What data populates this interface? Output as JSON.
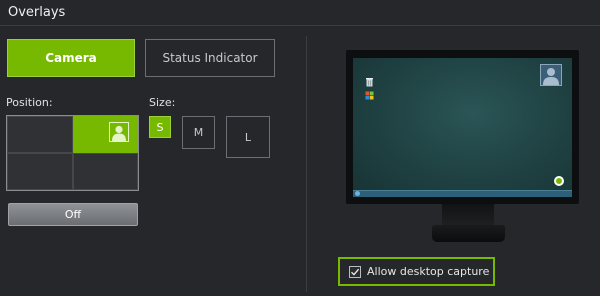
{
  "header": {
    "title": "Overlays"
  },
  "overlay_tabs": {
    "camera_label": "Camera",
    "status_indicator_label": "Status Indicator",
    "selected": "Camera"
  },
  "position": {
    "label": "Position:",
    "selected_cell": "top-right",
    "off_button_label": "Off"
  },
  "size": {
    "label": "Size:",
    "options": [
      "S",
      "M",
      "L"
    ],
    "selected": "S"
  },
  "preview": {
    "desktop_capture_label": "Allow desktop capture",
    "desktop_capture_checked": true
  },
  "colors": {
    "accent": "#76b900",
    "background": "#25272a"
  },
  "icons": {
    "camera_position_icon": "person-silhouette-icon",
    "desktop_person_icon": "person-silhouette-icon",
    "status_indicator_icon": "status-dot-icon",
    "checkbox_icon": "checkmark-icon"
  }
}
